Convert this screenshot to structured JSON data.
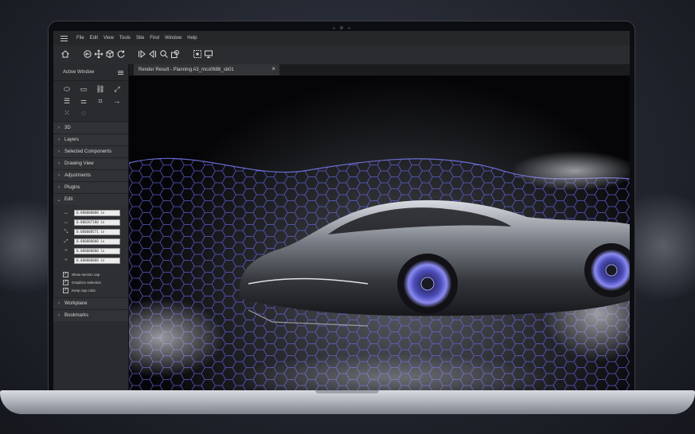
{
  "menubar": {
    "items": [
      "File",
      "Edit",
      "View",
      "Tools",
      "Site",
      "Find",
      "Window",
      "Help"
    ]
  },
  "toolbar": {
    "icons": [
      "home-icon",
      "orbit-icon",
      "pan-icon",
      "cube-icon",
      "refresh-icon",
      "play-forward-icon",
      "play-back-icon",
      "search-icon",
      "zoom-window-icon",
      "select-box-icon",
      "display-icon"
    ]
  },
  "panel": {
    "title": "Active Window",
    "sections_top": [
      "3D",
      "Layers",
      "Selected Components",
      "Drawing View",
      "Adjustments",
      "Plugins"
    ],
    "edit_label": "Edit",
    "fields": [
      "0.000000000 in",
      "0.000267180 in",
      "0.000008571 in",
      "0.000000000 in",
      "0.000000000 in",
      "0.000000000 in"
    ],
    "checks": [
      "Show section cap",
      "Graphics selection",
      "Keep cap color"
    ],
    "sections_bottom": [
      "Workplane",
      "Bookmarks"
    ]
  },
  "tab": {
    "title": "Render Result - Planning A3_mcs0688_sb01",
    "close": "×"
  },
  "colors": {
    "accent_glow": "#6f6fff",
    "panel_bg": "#2a2b2e",
    "menubar_bg": "#262729"
  }
}
